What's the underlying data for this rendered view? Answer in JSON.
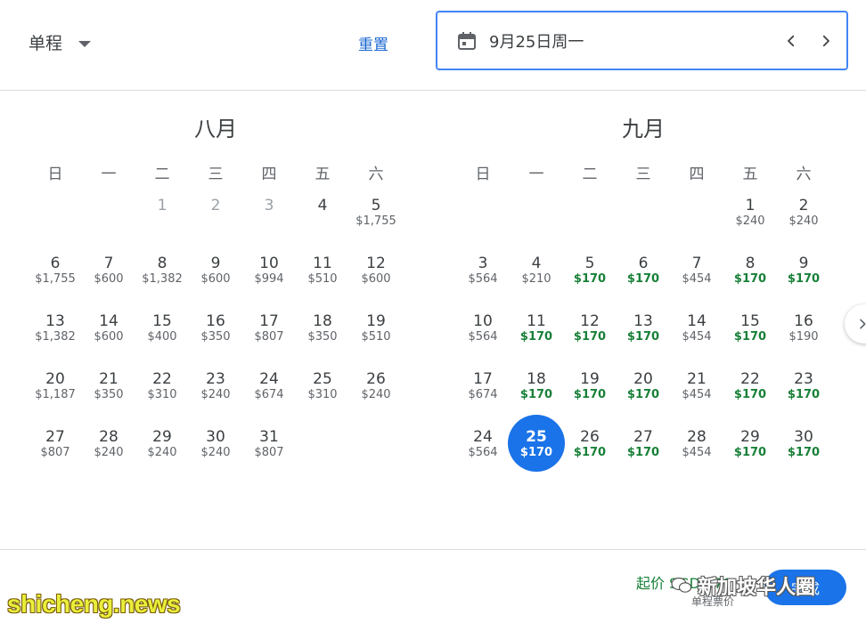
{
  "header": {
    "trip_type": "单程",
    "reset_label": "重置",
    "selected_date": "9月25日周一",
    "icons": {
      "trip_dropdown": "chevron-down-icon",
      "calendar": "calendar-icon",
      "prev": "chevron-left-icon",
      "next": "chevron-right-icon"
    }
  },
  "colors": {
    "accent": "#1a73e8",
    "low_price": "#188038",
    "reset_link": "#1967d2",
    "selected_background": "#1a73e8"
  },
  "calendar": {
    "months": [
      {
        "name": "八月",
        "weekdays": [
          "日",
          "一",
          "二",
          "三",
          "四",
          "五",
          "六"
        ],
        "days": [
          {
            "empty": true
          },
          {
            "empty": true
          },
          {
            "day": "1",
            "price": "",
            "disabled": true
          },
          {
            "day": "2",
            "price": "",
            "disabled": true
          },
          {
            "day": "3",
            "price": "",
            "disabled": true
          },
          {
            "day": "4",
            "price": ""
          },
          {
            "day": "5",
            "price": "$1,755"
          },
          {
            "day": "6",
            "price": "$1,755"
          },
          {
            "day": "7",
            "price": "$600"
          },
          {
            "day": "8",
            "price": "$1,382"
          },
          {
            "day": "9",
            "price": "$600"
          },
          {
            "day": "10",
            "price": "$994"
          },
          {
            "day": "11",
            "price": "$510"
          },
          {
            "day": "12",
            "price": "$600"
          },
          {
            "day": "13",
            "price": "$1,382"
          },
          {
            "day": "14",
            "price": "$600"
          },
          {
            "day": "15",
            "price": "$400"
          },
          {
            "day": "16",
            "price": "$350"
          },
          {
            "day": "17",
            "price": "$807"
          },
          {
            "day": "18",
            "price": "$350"
          },
          {
            "day": "19",
            "price": "$510"
          },
          {
            "day": "20",
            "price": "$1,187"
          },
          {
            "day": "21",
            "price": "$350"
          },
          {
            "day": "22",
            "price": "$310"
          },
          {
            "day": "23",
            "price": "$240"
          },
          {
            "day": "24",
            "price": "$674"
          },
          {
            "day": "25",
            "price": "$310"
          },
          {
            "day": "26",
            "price": "$240"
          },
          {
            "day": "27",
            "price": "$807"
          },
          {
            "day": "28",
            "price": "$240"
          },
          {
            "day": "29",
            "price": "$240"
          },
          {
            "day": "30",
            "price": "$240"
          },
          {
            "day": "31",
            "price": "$807"
          }
        ]
      },
      {
        "name": "九月",
        "weekdays": [
          "日",
          "一",
          "二",
          "三",
          "四",
          "五",
          "六"
        ],
        "days": [
          {
            "empty": true
          },
          {
            "empty": true
          },
          {
            "empty": true
          },
          {
            "empty": true
          },
          {
            "empty": true
          },
          {
            "day": "1",
            "price": "$240"
          },
          {
            "day": "2",
            "price": "$240"
          },
          {
            "day": "3",
            "price": "$564"
          },
          {
            "day": "4",
            "price": "$210"
          },
          {
            "day": "5",
            "price": "$170",
            "low": true
          },
          {
            "day": "6",
            "price": "$170",
            "low": true
          },
          {
            "day": "7",
            "price": "$454"
          },
          {
            "day": "8",
            "price": "$170",
            "low": true
          },
          {
            "day": "9",
            "price": "$170",
            "low": true
          },
          {
            "day": "10",
            "price": "$564"
          },
          {
            "day": "11",
            "price": "$170",
            "low": true
          },
          {
            "day": "12",
            "price": "$170",
            "low": true
          },
          {
            "day": "13",
            "price": "$170",
            "low": true
          },
          {
            "day": "14",
            "price": "$454"
          },
          {
            "day": "15",
            "price": "$170",
            "low": true
          },
          {
            "day": "16",
            "price": "$190"
          },
          {
            "day": "17",
            "price": "$674"
          },
          {
            "day": "18",
            "price": "$170",
            "low": true
          },
          {
            "day": "19",
            "price": "$170",
            "low": true
          },
          {
            "day": "20",
            "price": "$170",
            "low": true
          },
          {
            "day": "21",
            "price": "$454"
          },
          {
            "day": "22",
            "price": "$170",
            "low": true
          },
          {
            "day": "23",
            "price": "$170",
            "low": true
          },
          {
            "day": "24",
            "price": "$564"
          },
          {
            "day": "25",
            "price": "$170",
            "low": true,
            "selected": true
          },
          {
            "day": "26",
            "price": "$170",
            "low": true
          },
          {
            "day": "27",
            "price": "$170",
            "low": true
          },
          {
            "day": "28",
            "price": "$454"
          },
          {
            "day": "29",
            "price": "$170",
            "low": true
          },
          {
            "day": "30",
            "price": "$170",
            "low": true
          }
        ]
      }
    ]
  },
  "footer": {
    "from_price": "起价 SGD 170",
    "sub_note": "单程票价",
    "done_label": "完成"
  },
  "watermarks": {
    "site": "shicheng.news",
    "wechat": "新加坡华人圈"
  }
}
